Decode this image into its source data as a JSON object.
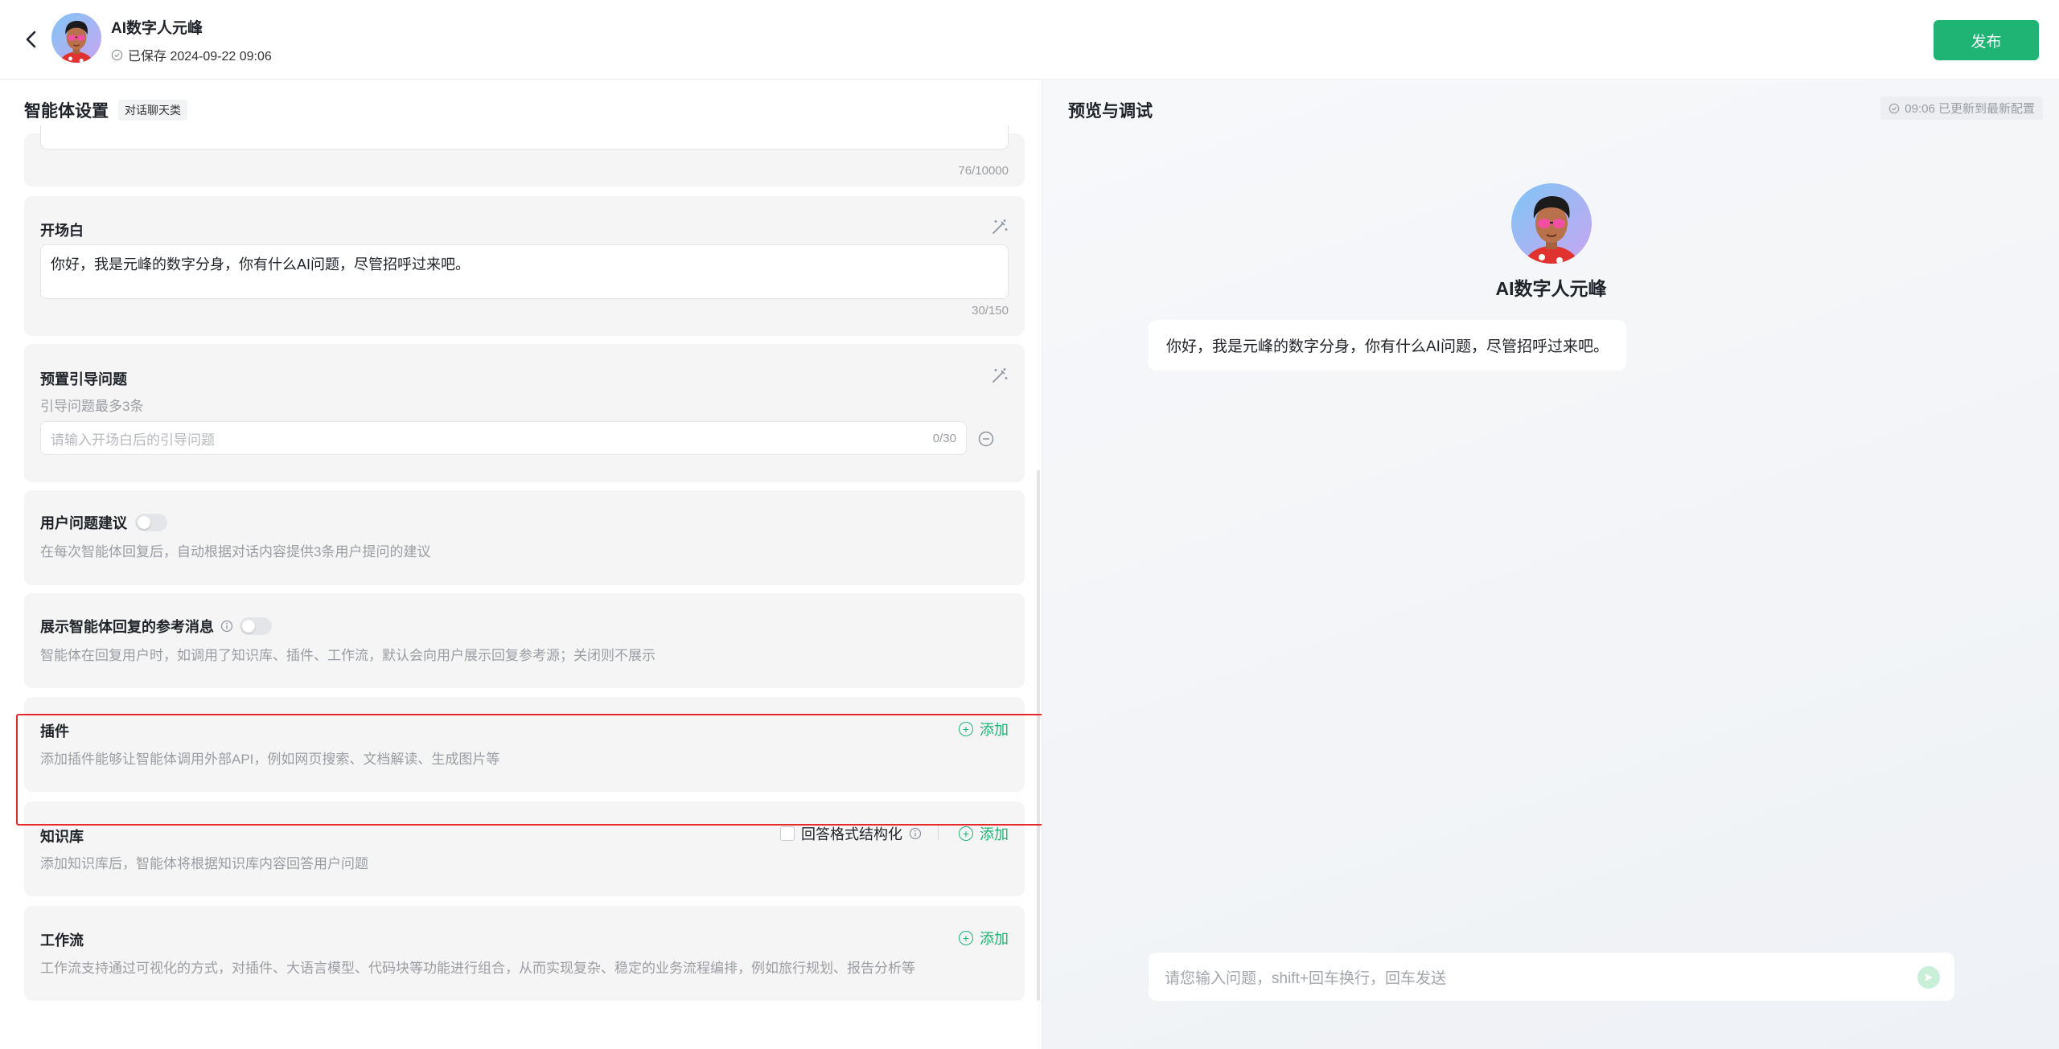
{
  "header": {
    "agent_name": "AI数字人元峰",
    "save_status": "已保存 2024-09-22 09:06",
    "publish_label": "发布"
  },
  "left": {
    "title": "智能体设置",
    "tag": "对话聊天类",
    "prompt_counter": "76/10000",
    "opening": {
      "title": "开场白",
      "text": "你好，我是元峰的数字分身，你有什么AI问题，尽管招呼过来吧。",
      "counter": "30/150"
    },
    "preset_questions": {
      "title": "预置引导问题",
      "desc": "引导问题最多3条",
      "placeholder": "请输入开场白后的引导问题",
      "counter": "0/30"
    },
    "user_suggest": {
      "title": "用户问题建议",
      "desc": "在每次智能体回复后，自动根据对话内容提供3条用户提问的建议"
    },
    "show_refs": {
      "title": "展示智能体回复的参考消息",
      "desc": "智能体在回复用户时，如调用了知识库、插件、工作流，默认会向用户展示回复参考源；关闭则不展示"
    },
    "plugins": {
      "title": "插件",
      "desc": "添加插件能够让智能体调用外部API，例如网页搜索、文档解读、生成图片等",
      "add_label": "添加"
    },
    "knowledge": {
      "title": "知识库",
      "desc": "添加知识库后，智能体将根据知识库内容回答用户问题",
      "structured_label": "回答格式结构化",
      "add_label": "添加"
    },
    "workflow": {
      "title": "工作流",
      "desc": "工作流支持通过可视化的方式，对插件、大语言模型、代码块等功能进行组合，从而实现复杂、稳定的业务流程编排，例如旅行规划、报告分析等",
      "add_label": "添加"
    }
  },
  "right": {
    "title": "预览与调试",
    "status": "09:06 已更新到最新配置",
    "agent_name": "AI数字人元峰",
    "greeting": "你好，我是元峰的数字分身，你有什么AI问题，尽管招呼过来吧。",
    "input_placeholder": "请您输入问题，shift+回车换行，回车发送"
  },
  "colors": {
    "accent": "#1fb374",
    "highlight": "#e5292a"
  }
}
